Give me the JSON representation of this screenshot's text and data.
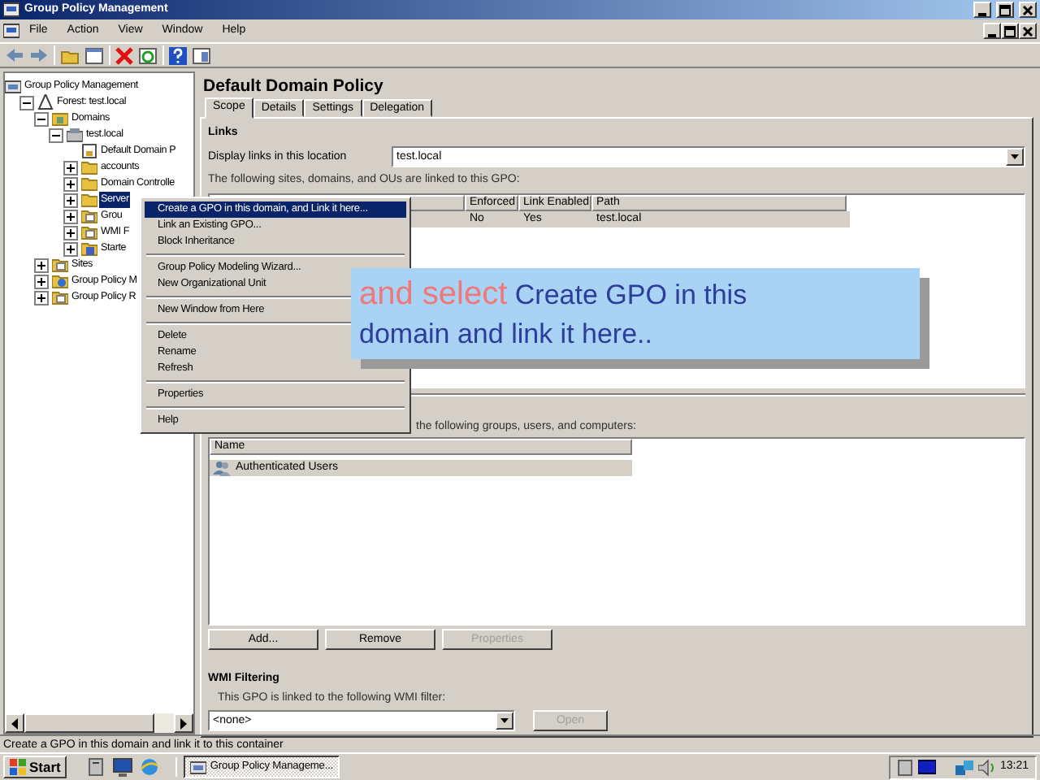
{
  "window": {
    "title": "Group Policy Management"
  },
  "menu_bar": [
    "File",
    "Action",
    "View",
    "Window",
    "Help"
  ],
  "tree": [
    {
      "label": "Group Policy Management",
      "kind": "console",
      "selected": false,
      "children": [
        {
          "label": "Forest: test.local",
          "kind": "forest",
          "selected": false,
          "expanded": true,
          "children": [
            {
              "label": "Domains",
              "kind": "domains",
              "selected": false,
              "expanded": true,
              "children": [
                {
                  "label": "test.local",
                  "kind": "domain",
                  "selected": false,
                  "expanded": true,
                  "children": [
                    {
                      "label": "Default Domain P",
                      "kind": "gpo",
                      "selected": false
                    },
                    {
                      "label": "accounts",
                      "kind": "ou",
                      "selected": false,
                      "expanded": false
                    },
                    {
                      "label": "Domain Controlle",
                      "kind": "ou",
                      "selected": false,
                      "expanded": false
                    },
                    {
                      "label": "Server",
                      "kind": "ou",
                      "selected": true,
                      "expanded": false
                    },
                    {
                      "label": "Grou",
                      "kind": "folder",
                      "selected": false,
                      "expanded": false
                    },
                    {
                      "label": "WMI F",
                      "kind": "folder",
                      "selected": false,
                      "expanded": false
                    },
                    {
                      "label": "Starte",
                      "kind": "starter",
                      "selected": false,
                      "expanded": false
                    }
                  ]
                }
              ]
            },
            {
              "label": "Sites",
              "kind": "folder",
              "selected": false,
              "expanded": false
            },
            {
              "label": "Group Policy M",
              "kind": "modeling",
              "selected": false,
              "expanded": false
            },
            {
              "label": "Group Policy R",
              "kind": "folder",
              "selected": false,
              "expanded": false
            }
          ]
        }
      ]
    }
  ],
  "details": {
    "title": "Default Domain Policy",
    "tabs": [
      {
        "label": "Scope",
        "selected": true
      },
      {
        "label": "Details",
        "selected": false
      },
      {
        "label": "Settings",
        "selected": false
      },
      {
        "label": "Delegation",
        "selected": false
      }
    ],
    "links": {
      "heading": "Links",
      "location_label": "Display links in this location",
      "location_value": "test.local",
      "description": "The following sites, domains, and OUs are linked to this GPO:",
      "columns": [
        "Enforced",
        "Link Enabled",
        "Path"
      ],
      "rows": [
        {
          "cells": [
            "No",
            "Yes",
            "test.local"
          ],
          "selected": true
        }
      ]
    },
    "security_filtering": {
      "description": "the following groups, users, and computers:",
      "columns": [
        "Name"
      ],
      "rows": [
        {
          "label": "Authenticated Users",
          "selected": true
        }
      ],
      "buttons": [
        {
          "label": "Add...",
          "disabled": false
        },
        {
          "label": "Remove",
          "disabled": false
        },
        {
          "label": "Properties",
          "disabled": true
        }
      ]
    },
    "wmi_filtering": {
      "heading": "WMI Filtering",
      "description": "This GPO is linked to the following WMI filter:",
      "value": "<none>",
      "button": {
        "label": "Open",
        "disabled": true
      }
    }
  },
  "context_menu": [
    [
      {
        "label": "Create a GPO in this domain, and Link it here...",
        "selected": true
      },
      {
        "label": "Link an Existing GPO...",
        "selected": false
      },
      {
        "label": "Block Inheritance",
        "selected": false
      }
    ],
    [
      {
        "label": "Group Policy Modeling Wizard...",
        "selected": false
      },
      {
        "label": "New Organizational Unit",
        "selected": false
      }
    ],
    [
      {
        "label": "New Window from Here",
        "selected": false
      }
    ],
    [
      {
        "label": "Delete",
        "selected": false
      },
      {
        "label": "Rename",
        "selected": false
      },
      {
        "label": "Refresh",
        "selected": false
      }
    ],
    [
      {
        "label": "Properties",
        "selected": false
      }
    ],
    [
      {
        "label": "Help",
        "selected": false
      }
    ]
  ],
  "callout": {
    "lead": "and select",
    "action": "Create GPO in this domain and link it here.."
  },
  "status_bar": "Create a GPO in this domain and link it to this container",
  "taskbar": {
    "start": "Start",
    "tasks": [
      {
        "label": "Group Policy Manageme...",
        "selected": true
      }
    ],
    "clock": "13:21"
  }
}
